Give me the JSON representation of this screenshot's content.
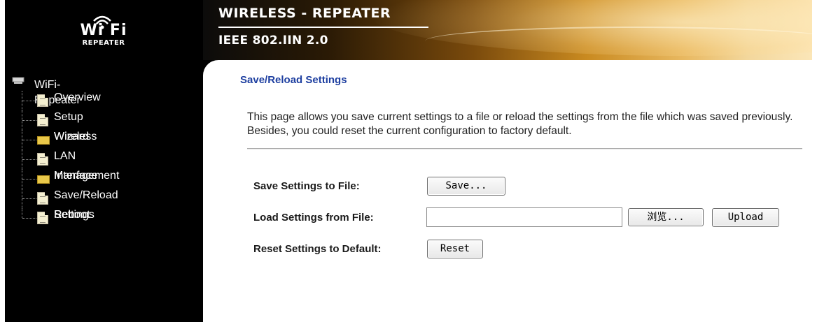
{
  "brand": {
    "logo_wifi": "Wi Fi",
    "logo_sub": "REPEATER",
    "title": "WIRELESS - REPEATER",
    "subtitle": "IEEE 802.IIN 2.0"
  },
  "sidebar": {
    "root": "WiFi-Repeater",
    "items": [
      {
        "label": "Overview",
        "icon": "document-icon"
      },
      {
        "label": "Setup Wizard",
        "icon": "document-icon"
      },
      {
        "label": "Wireless",
        "icon": "folder-icon"
      },
      {
        "label": "LAN Interface",
        "icon": "document-icon"
      },
      {
        "label": "Management",
        "icon": "folder-icon"
      },
      {
        "label": "Save/Reload Settings",
        "icon": "document-icon"
      },
      {
        "label": "Reboot",
        "icon": "document-icon"
      }
    ]
  },
  "main": {
    "title": "Save/Reload Settings",
    "description": "This page allows you save current settings to a file or reload the settings from the file which was saved previously. Besides, you could reset the current configuration to factory default.",
    "rows": {
      "save_label": "Save Settings to File:",
      "save_button": "Save...",
      "load_label": "Load Settings from File:",
      "file_value": "",
      "browse_button": "浏览...",
      "upload_button": "Upload",
      "reset_label": "Reset Settings to Default:",
      "reset_button": "Reset"
    }
  },
  "colors": {
    "title_blue": "#1e3fa0",
    "header_gold": "#c98a20"
  }
}
